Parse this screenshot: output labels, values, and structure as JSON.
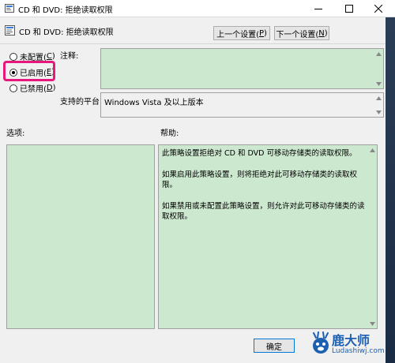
{
  "window": {
    "title": "CD 和 DVD: 拒绝读取权限",
    "controls": {
      "minimize": "minimize-icon",
      "maximize": "maximize-icon",
      "close": "close-icon"
    }
  },
  "header": {
    "policy_title": "CD 和 DVD: 拒绝读取权限",
    "prev_setting": "上一个设置(",
    "prev_setting_key": "P",
    "prev_setting_end": ")",
    "next_setting": "下一个设置(",
    "next_setting_key": "N",
    "next_setting_end": ")"
  },
  "state_options": [
    {
      "label": "未配置(",
      "key": "C",
      "end": ")",
      "selected": false
    },
    {
      "label": "已启用(",
      "key": "E",
      "end": ")",
      "selected": true
    },
    {
      "label": "已禁用(",
      "key": "D",
      "end": ")",
      "selected": false
    }
  ],
  "comment": {
    "label": "注释:",
    "value": ""
  },
  "supported_on": {
    "label": "支持的平台:",
    "value": "Windows Vista 及以上版本"
  },
  "options": {
    "label": "选项:"
  },
  "help": {
    "label": "帮助:",
    "paragraphs": [
      "此策略设置拒绝对 CD 和 DVD 可移动存储类的读取权限。",
      "如果启用此策略设置，则将拒绝对此可移动存储类的读取权限。",
      "如果禁用或未配置此策略设置，则允许对此可移动存储类的读取权限。"
    ]
  },
  "footer": {
    "ok": "确定"
  },
  "watermark": {
    "name": "鹿大师",
    "url": "Ludashiwj.com"
  },
  "colors": {
    "panel": "#cce8cf",
    "highlight": "#e8177b",
    "watermark": "#1d5fb0"
  }
}
